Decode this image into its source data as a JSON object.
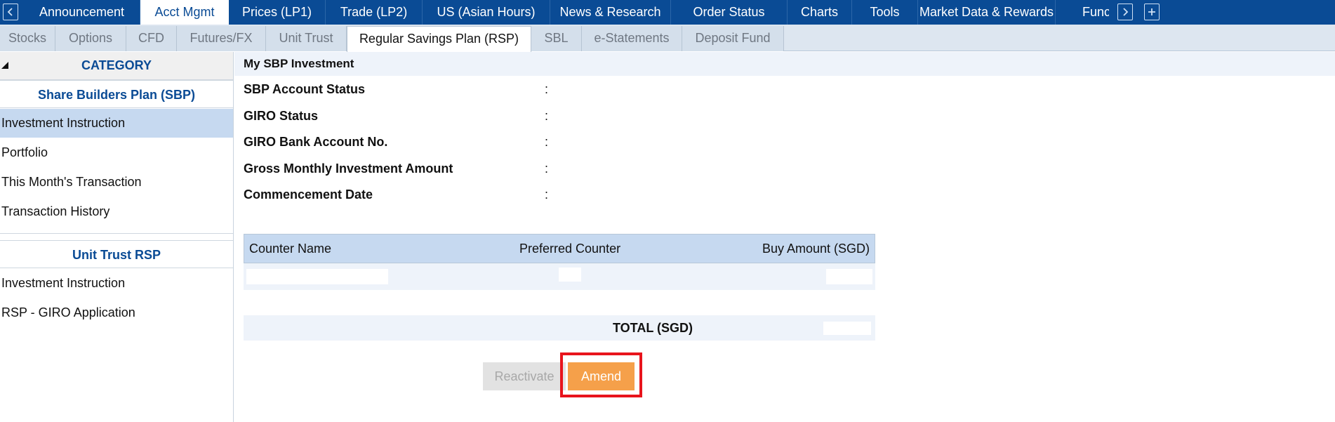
{
  "top_nav": {
    "prev_icon": "chevron-left-icon",
    "next_icon": "chevron-right-icon",
    "add_icon": "plus-icon",
    "tabs": [
      {
        "label": "Announcement",
        "active": false
      },
      {
        "label": "Acct Mgmt",
        "active": true
      },
      {
        "label": "Prices (LP1)",
        "active": false
      },
      {
        "label": "Trade (LP2)",
        "active": false
      },
      {
        "label": "US (Asian Hours)",
        "active": false
      },
      {
        "label": "News & Research",
        "active": false
      },
      {
        "label": "Order Status",
        "active": false
      },
      {
        "label": "Charts",
        "active": false
      },
      {
        "label": "Tools",
        "active": false
      },
      {
        "label": "Market Data & Rewards",
        "active": false
      },
      {
        "label": "Func",
        "active": false
      }
    ]
  },
  "sub_nav": {
    "tabs": [
      {
        "label": "Stocks",
        "active": false
      },
      {
        "label": "Options",
        "active": false
      },
      {
        "label": "CFD",
        "active": false
      },
      {
        "label": "Futures/FX",
        "active": false
      },
      {
        "label": "Unit Trust",
        "active": false
      },
      {
        "label": "Regular Savings Plan (RSP)",
        "active": true
      },
      {
        "label": "SBL",
        "active": false
      },
      {
        "label": "e-Statements",
        "active": false
      },
      {
        "label": "Deposit Fund",
        "active": false
      }
    ]
  },
  "sidebar": {
    "category_label": "CATEGORY",
    "groups": [
      {
        "title": "Share Builders Plan (SBP)",
        "items": [
          {
            "label": "Investment Instruction",
            "active": true
          },
          {
            "label": "Portfolio",
            "active": false
          },
          {
            "label": "This Month's Transaction",
            "active": false
          },
          {
            "label": "Transaction History",
            "active": false
          }
        ]
      },
      {
        "title": "Unit Trust RSP",
        "items": [
          {
            "label": "Investment Instruction",
            "active": false
          },
          {
            "label": "RSP - GIRO Application",
            "active": false
          }
        ]
      }
    ]
  },
  "main": {
    "section_title": "My SBP Investment",
    "fields": [
      {
        "label": "SBP Account Status",
        "value": ""
      },
      {
        "label": "GIRO Status",
        "value": ""
      },
      {
        "label": "GIRO Bank Account No.",
        "value": ""
      },
      {
        "label": "Gross Monthly Investment Amount",
        "value": ""
      },
      {
        "label": "Commencement Date",
        "value": ""
      }
    ],
    "colon": ":",
    "table": {
      "columns": [
        "Counter Name",
        "Preferred Counter",
        "Buy Amount (SGD)"
      ],
      "rows": [
        [
          "",
          "",
          ""
        ]
      ]
    },
    "total_label": "TOTAL (SGD)",
    "total_value": "",
    "buttons": {
      "reactivate": "Reactivate",
      "amend": "Amend"
    }
  },
  "colors": {
    "nav_blue": "#0a4b95",
    "highlight_red": "#e8141c",
    "amend_orange": "#f5a04a"
  }
}
